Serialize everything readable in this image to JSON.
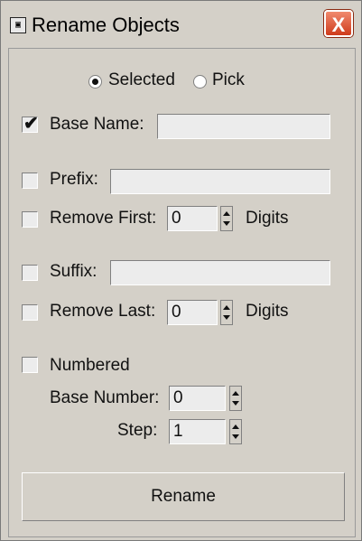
{
  "window": {
    "title": "Rename Objects",
    "close_glyph": "X"
  },
  "source": {
    "selected_label": "Selected",
    "pick_label": "Pick",
    "selected_checked": true
  },
  "base_name": {
    "label": "Base Name:",
    "checked": true,
    "value": ""
  },
  "prefix": {
    "label": "Prefix:",
    "checked": false,
    "value": ""
  },
  "remove_first": {
    "label": "Remove First:",
    "checked": false,
    "value": "0",
    "unit": "Digits"
  },
  "suffix": {
    "label": "Suffix:",
    "checked": false,
    "value": ""
  },
  "remove_last": {
    "label": "Remove Last:",
    "checked": false,
    "value": "0",
    "unit": "Digits"
  },
  "numbered": {
    "label": "Numbered",
    "checked": false,
    "base_number_label": "Base Number:",
    "base_number_value": "0",
    "step_label": "Step:",
    "step_value": "1"
  },
  "actions": {
    "rename_label": "Rename"
  },
  "icons": {
    "window_icon": "app-icon",
    "checkmark": "✔"
  }
}
